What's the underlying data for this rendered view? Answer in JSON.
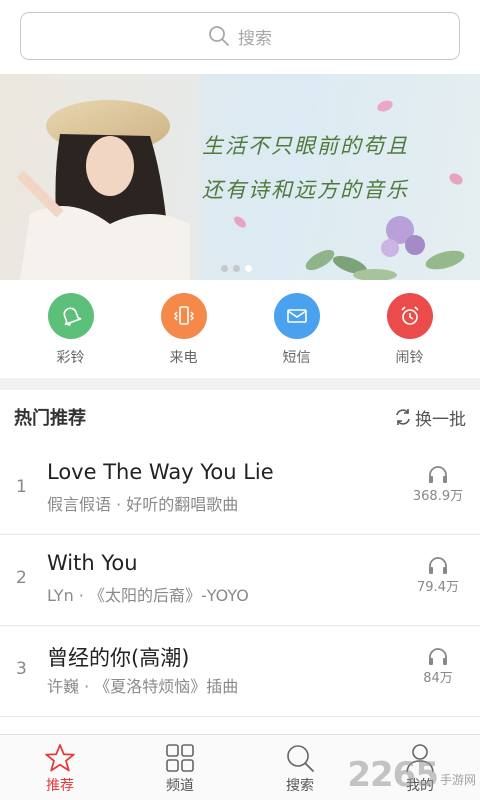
{
  "search": {
    "placeholder": "搜索"
  },
  "banner": {
    "line1": "生活不只眼前的苟且",
    "line2": "还有诗和远方的音乐",
    "slides": 3,
    "active_slide": 3
  },
  "quick": [
    {
      "label": "彩铃",
      "icon": "bell-icon",
      "color": "#5cbf7a"
    },
    {
      "label": "来电",
      "icon": "phone-vibrate-icon",
      "color": "#f5894a"
    },
    {
      "label": "短信",
      "icon": "envelope-icon",
      "color": "#4aa1ef"
    },
    {
      "label": "闹铃",
      "icon": "alarm-clock-icon",
      "color": "#ec4b4b"
    }
  ],
  "hot": {
    "title": "热门推荐",
    "refresh_label": "换一批",
    "items": [
      {
        "index": "1",
        "title": "Love The Way You Lie",
        "subtitle": "假言假语 · 好听的翻唱歌曲",
        "plays": "368.9万"
      },
      {
        "index": "2",
        "title": "With You",
        "subtitle": "LYn · 《太阳的后裔》-YOYO",
        "plays": "79.4万"
      },
      {
        "index": "3",
        "title": "曾经的你(高潮)",
        "subtitle": "许巍 · 《夏洛特烦恼》插曲",
        "plays": "84万"
      }
    ]
  },
  "tabs": [
    {
      "label": "推荐",
      "icon": "star-icon",
      "active": true
    },
    {
      "label": "频道",
      "icon": "grid-icon",
      "active": false
    },
    {
      "label": "搜索",
      "icon": "search-icon",
      "active": false
    },
    {
      "label": "我的",
      "icon": "user-icon",
      "active": false
    }
  ],
  "watermark": {
    "number": "2265",
    "text": "手游网"
  },
  "colors": {
    "accent": "#e63b3b",
    "banner_text": "#4f7a3c"
  }
}
